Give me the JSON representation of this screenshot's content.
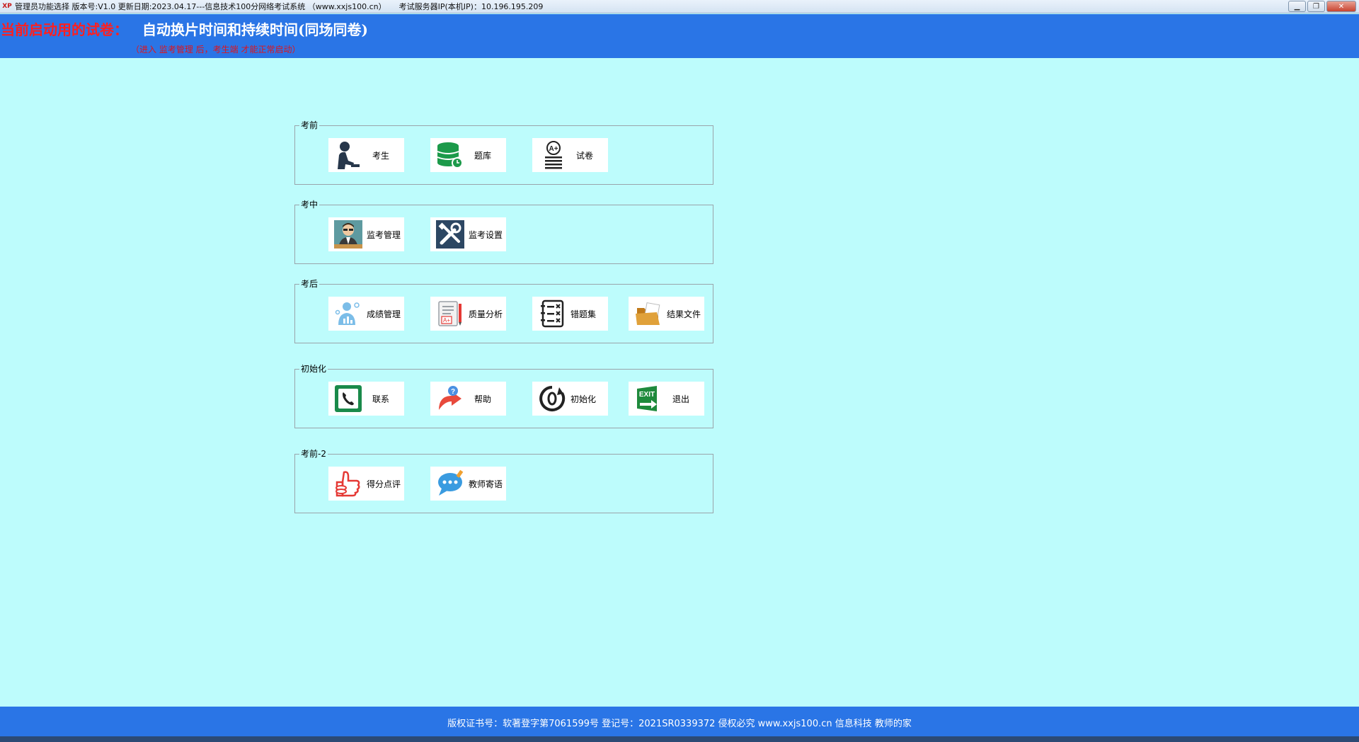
{
  "window": {
    "title": "管理员功能选择 版本号:V1.0 更新日期:2023.04.17---信息技术100分网络考试系统 （www.xxjs100.cn）",
    "server_info": "考试服务器IP(本机IP)：10.196.195.209",
    "app_icon_text": "XP"
  },
  "header": {
    "label": "当前启动用的试卷：",
    "exam_name": "自动换片时间和持续时间(同场同卷)",
    "notice": "（进入 监考管理 后，考生端 才能正常启动）"
  },
  "groups": [
    {
      "title": "考前",
      "items": [
        {
          "label": "考生",
          "icon": "student-icon"
        },
        {
          "label": "题库",
          "icon": "database-icon"
        },
        {
          "label": "试卷",
          "icon": "exam-paper-icon"
        }
      ]
    },
    {
      "title": "考中",
      "items": [
        {
          "label": "监考管理",
          "icon": "proctor-icon"
        },
        {
          "label": "监考设置",
          "icon": "tools-icon"
        }
      ]
    },
    {
      "title": "考后",
      "items": [
        {
          "label": "成绩管理",
          "icon": "score-chart-icon"
        },
        {
          "label": "质量分析",
          "icon": "quality-report-icon"
        },
        {
          "label": "错题集",
          "icon": "checklist-icon"
        },
        {
          "label": "结果文件",
          "icon": "folder-icon"
        }
      ]
    },
    {
      "title": "初始化",
      "items": [
        {
          "label": "联系",
          "icon": "phone-icon"
        },
        {
          "label": "帮助",
          "icon": "help-icon"
        },
        {
          "label": "初始化",
          "icon": "reset-icon"
        },
        {
          "label": "退出",
          "icon": "exit-icon"
        }
      ]
    },
    {
      "title": "考前-2",
      "items": [
        {
          "label": "得分点评",
          "icon": "thumbs-up-icon"
        },
        {
          "label": "教师寄语",
          "icon": "chat-bubble-icon"
        }
      ]
    }
  ],
  "footer": {
    "copyright": "版权证书号：软著登字第7061599号 登记号：2021SR0339372  侵权必究  www.xxjs100.cn  信息科技 教师的家"
  },
  "colors": {
    "header_bg": "#2a75e6",
    "page_bg": "#bdfcfc",
    "label_red": "#ff1f1f"
  }
}
